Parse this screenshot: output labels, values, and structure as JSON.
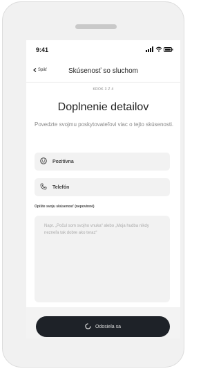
{
  "status_bar": {
    "time": "9:41"
  },
  "nav": {
    "back_label": "Späť",
    "title": "Skúsenosť so sluchom"
  },
  "step_label": "KROK 3 Z 4",
  "heading": "Doplnenie detailov",
  "description": "Povedzte svojmu poskytovateľovi viac o tejto skúsenosti.",
  "fields": [
    {
      "icon": "smiley-icon",
      "label": "Pozitívna"
    },
    {
      "icon": "phone-icon",
      "label": "Telefón"
    }
  ],
  "experience": {
    "label": "Opíšte svoju skúsenosť (nepovinné)",
    "placeholder": "Napr. „Počul som svojho vnuka“ alebo „Moja hudba nikdy nezneľa tak dobre ako teraz“"
  },
  "submit": {
    "label": "Odosiela sa",
    "icon": "loading-spinner-icon"
  },
  "colors": {
    "button_bg": "#1e2228",
    "field_bg": "#f2f2f2"
  }
}
